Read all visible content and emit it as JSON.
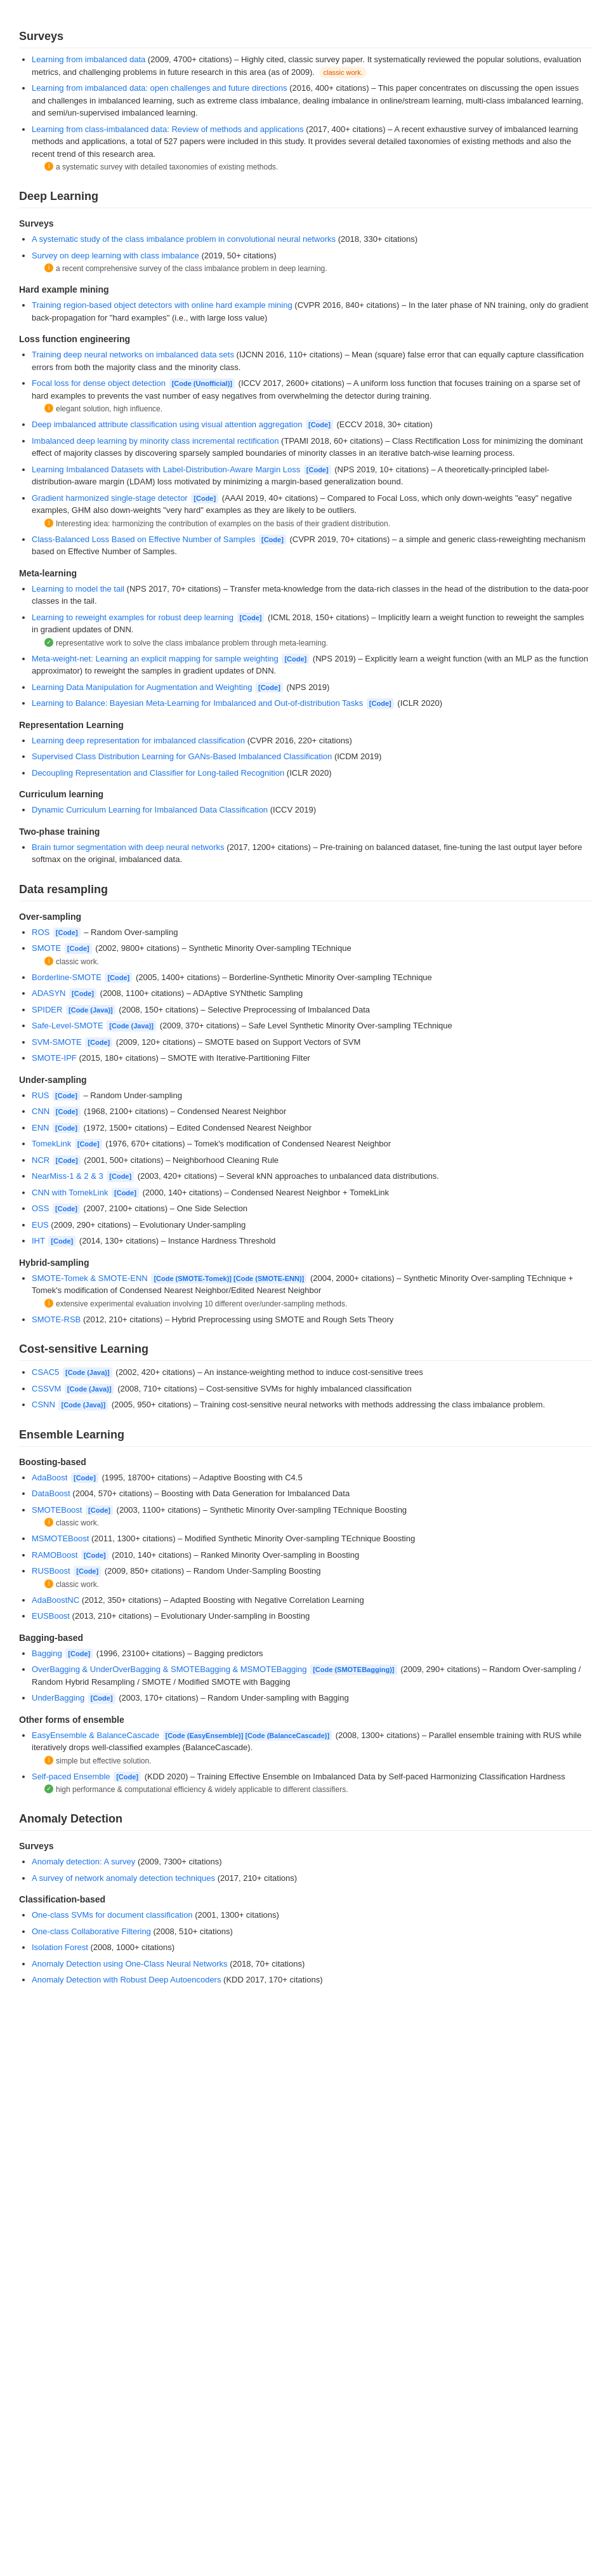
{
  "sections": [
    {
      "title": "Surveys",
      "id": "surveys-top",
      "content": {
        "subsections": [],
        "items": [
          {
            "link": "Learning from imbalanced data",
            "meta": "(2009, 4700+ citations)",
            "desc": "– Highly cited, classic survey paper. It systematically reviewed the popular solutions, evaluation metrics, and challenging problems in future research in this area (as of 2009).",
            "badge": "classic work."
          },
          {
            "link": "Learning from imbalanced data: open challenges and future directions",
            "meta": "(2016, 400+ citations)",
            "desc": "– This paper concentrates on discussing the open issues and challenges in imbalanced learning, such as extreme class imbalance, dealing imbalance in online/stream learning, multi-class imbalanced learning, and semi/un-supervised imbalanced learning."
          },
          {
            "link": "Learning from class-imbalanced data: Review of methods and applications",
            "meta": "(2017, 400+ citations)",
            "desc": "– A recent exhaustive survey of imbalanced learning methods and applications, a total of 527 papers were included in this study. It provides several detailed taxonomies of existing methods and also the recent trend of this research area.",
            "sub_note": "a systematic survey with detailed taxonomies of existing methods.",
            "sub_note_icon": "orange"
          }
        ]
      }
    },
    {
      "title": "Deep Learning",
      "id": "deep-learning",
      "content": {
        "subsections": [
          {
            "label": "Surveys",
            "items": [
              {
                "link": "A systematic study of the class imbalance problem in convolutional neural networks",
                "meta": "(2018, 330+ citations)"
              },
              {
                "link": "Survey on deep learning with class imbalance",
                "meta": "(2019, 50+ citations)",
                "sub_note": "a recent comprehensive survey of the class imbalance problem in deep learning.",
                "sub_note_icon": "orange"
              }
            ]
          },
          {
            "label": "Hard example mining",
            "items": [
              {
                "link": "Training region-based object detectors with online hard example mining",
                "meta": "(CVPR 2016, 840+ citations)",
                "desc": "– In the later phase of NN training, only do gradient back-propagation for \"hard examples\" (i.e., with large loss value)"
              }
            ]
          },
          {
            "label": "Loss function engineering",
            "items": [
              {
                "link": "Training deep neural networks on imbalanced data sets",
                "meta": "(IJCNN 2016, 110+ citations)",
                "desc": "– Mean (square) false error that can equally capture classification errors from both the majority class and the minority class."
              },
              {
                "link": "Focal loss for dense object detection",
                "tag": "[Code (Unofficial)]",
                "meta": "(ICCV 2017, 2600+ citations)",
                "desc": "– A uniform loss function that focuses training on a sparse set of hard examples to prevents the vast number of easy negatives from overwhelming the detector during training.",
                "sub_note": "elegant solution, high influence.",
                "sub_note_icon": "orange"
              },
              {
                "link": "Deep imbalanced attribute classification using visual attention aggregation",
                "tag": "[Code]",
                "meta": "(ECCV 2018, 30+ citation)"
              },
              {
                "link": "Imbalanced deep learning by minority class incremental rectification",
                "meta": "(TPAMI 2018, 60+ citations)",
                "desc": "– Class Rectification Loss for minimizing the dominant effect of majority classes by discovering sparsely sampled boundaries of minority classes in an iterative batch-wise learning process."
              },
              {
                "link": "Learning Imbalanced Datasets with Label-Distribution-Aware Margin Loss",
                "tag": "[Code]",
                "meta": "(NPS 2019, 10+ citations)",
                "desc": "– A theoretically-principled label-distribution-aware margin (LDAM) loss motivated by minimizing a margin-based generalization bound."
              },
              {
                "link": "Gradient harmonized single-stage detector",
                "tag": "[Code]",
                "meta": "(AAAI 2019, 40+ citations)",
                "desc": "– Compared to Focal Loss, which only down-weights \"easy\" negative examples, GHM also down-weights \"very hard\" examples as they are likely to be outliers.",
                "sub_note": "Interesting idea: harmonizing the contribution of examples on the basis of their gradient distribution.",
                "sub_note_icon": "orange"
              },
              {
                "link": "Class-Balanced Loss Based on Effective Number of Samples",
                "tag": "[Code]",
                "meta": "(CVPR 2019, 70+ citations)",
                "desc": "– a simple and generic class-reweighting mechanism based on Effective Number of Samples."
              }
            ]
          },
          {
            "label": "Meta-learning",
            "items": [
              {
                "link": "Learning to model the tail",
                "meta": "(NPS 2017, 70+ citations)",
                "desc": "– Transfer meta-knowledge from the data-rich classes in the head of the distribution to the data-poor classes in the tail."
              },
              {
                "link": "Learning to reweight examples for robust deep learning",
                "tag": "[Code]",
                "meta": "(ICML 2018, 150+ citations)",
                "desc": "– Implicitly learn a weight function to reweight the samples in gradient updates of DNN.",
                "sub_note": "representative work to solve the class imbalance problem through meta-learning.",
                "sub_note_icon": "green"
              },
              {
                "link": "Meta-weight-net: Learning an explicit mapping for sample weighting",
                "tag": "[Code]",
                "meta": "(NPS 2019)",
                "desc": "– Explicitly learn a weight function (with an MLP as the function approximator) to reweight the samples in gradient updates of DNN."
              },
              {
                "link": "Learning Data Manipulation for Augmentation and Weighting",
                "tag": "[Code]",
                "meta": "(NPS 2019)"
              },
              {
                "link": "Learning to Balance: Bayesian Meta-Learning for Imbalanced and Out-of-distribution Tasks",
                "tag": "[Code]",
                "meta": "(ICLR 2020)"
              }
            ]
          },
          {
            "label": "Representation Learning",
            "items": [
              {
                "link": "Learning deep representation for imbalanced classification",
                "meta": "(CVPR 2016, 220+ citations)"
              },
              {
                "link": "Supervised Class Distribution Learning for GANs-Based Imbalanced Classification",
                "meta": "(ICDM 2019)"
              },
              {
                "link": "Decoupling Representation and Classifier for Long-tailed Recognition",
                "meta": "(ICLR 2020)"
              }
            ]
          },
          {
            "label": "Curriculum learning",
            "items": [
              {
                "link": "Dynamic Curriculum Learning for Imbalanced Data Classification",
                "meta": "(ICCV 2019)"
              }
            ]
          },
          {
            "label": "Two-phase training",
            "items": [
              {
                "link": "Brain tumor segmentation with deep neural networks",
                "meta": "(2017, 1200+ citations)",
                "desc": "– Pre-training on balanced dataset, fine-tuning the last output layer before softmax on the original, imbalanced data."
              }
            ]
          }
        ]
      }
    },
    {
      "title": "Data resampling",
      "id": "data-resampling",
      "content": {
        "subsections": [
          {
            "label": "Over-sampling",
            "items": [
              {
                "link": "ROS",
                "tag": "[Code]",
                "desc": "– Random Over-sampling"
              },
              {
                "link": "SMOTE",
                "tag": "[Code]",
                "meta": "(2002, 9800+ citations)",
                "desc": "– Synthetic Minority Over-sampling TEchnique",
                "sub_note": "classic work.",
                "sub_note_icon": "orange"
              },
              {
                "link": "Borderline-SMOTE",
                "tag": "[Code]",
                "meta": "(2005, 1400+ citations)",
                "desc": "– Borderline-Synthetic Minority Over-sampling TEchnique"
              },
              {
                "link": "ADASYN",
                "tag": "[Code]",
                "meta": "(2008, 1100+ citations)",
                "desc": "– ADAptive SYNthetic Sampling"
              },
              {
                "link": "SPIDER",
                "tag": "[Code (Java)]",
                "meta": "(2008, 150+ citations)",
                "desc": "– Selective Preprocessing of Imbalanced Data"
              },
              {
                "link": "Safe-Level-SMOTE",
                "tag": "[Code (Java)]",
                "meta": "(2009, 370+ citations)",
                "desc": "– Safe Level Synthetic Minority Over-sampling TEchnique"
              },
              {
                "link": "SVM-SMOTE",
                "tag": "[Code]",
                "meta": "(2009, 120+ citations)",
                "desc": "– SMOTE based on Support Vectors of SVM"
              },
              {
                "link": "SMOTE-IPF",
                "meta": "(2015, 180+ citations)",
                "desc": "– SMOTE with Iterative-Partitioning Filter"
              }
            ]
          },
          {
            "label": "Under-sampling",
            "items": [
              {
                "link": "RUS",
                "tag": "[Code]",
                "desc": "– Random Under-sampling"
              },
              {
                "link": "CNN",
                "tag": "[Code]",
                "meta": "(1968, 2100+ citations)",
                "desc": "– Condensed Nearest Neighbor"
              },
              {
                "link": "ENN",
                "tag": "[Code]",
                "meta": "(1972, 1500+ citations)",
                "desc": "– Edited Condensed Nearest Neighbor"
              },
              {
                "link": "TomekLink",
                "tag": "[Code]",
                "meta": "(1976, 670+ citations)",
                "desc": "– Tomek's modification of Condensed Nearest Neighbor"
              },
              {
                "link": "NCR",
                "tag": "[Code]",
                "meta": "(2001, 500+ citations)",
                "desc": "– Neighborhood Cleaning Rule"
              },
              {
                "link": "NearMiss-1 & 2 & 3",
                "tag": "[Code]",
                "meta": "(2003, 420+ citations)",
                "desc": "– Several kNN approaches to unbalanced data distributions."
              },
              {
                "link": "CNN with TomekLink",
                "tag": "[Code]",
                "meta": "(2000, 140+ citations)",
                "desc": "– Condensed Nearest Neighbor + TomekLink"
              },
              {
                "link": "OSS",
                "tag": "[Code]",
                "meta": "(2007, 2100+ citations)",
                "desc": "– One Side Selection"
              },
              {
                "link": "EUS",
                "meta": "(2009, 290+ citations)",
                "desc": "– Evolutionary Under-sampling"
              },
              {
                "link": "IHT",
                "tag": "[Code]",
                "meta": "(2014, 130+ citations)",
                "desc": "– Instance Hardness Threshold"
              }
            ]
          },
          {
            "label": "Hybrid-sampling",
            "items": [
              {
                "link": "SMOTE-Tomek & SMOTE-ENN",
                "tag": "[Code (SMOTE-Tomek)] [Code (SMOTE-ENN)]",
                "meta": "(2004, 2000+ citations)",
                "desc": "– Synthetic Minority Over-sampling TEchnique + Tomek's modification of Condensed Nearest Neighbor/Edited Nearest Neighbor",
                "sub_note": "extensive experimental evaluation involving 10 different over/under-sampling methods.",
                "sub_note_icon": "orange"
              },
              {
                "link": "SMOTE-RSB",
                "meta": "(2012, 210+ citations)",
                "desc": "– Hybrid Preprocessing using SMOTE and Rough Sets Theory"
              }
            ]
          }
        ]
      }
    },
    {
      "title": "Cost-sensitive Learning",
      "id": "cost-sensitive",
      "content": {
        "subsections": [],
        "items": [
          {
            "link": "CSAC5",
            "tag": "[Code (Java)]",
            "meta": "(2002, 420+ citations)",
            "desc": "– An instance-weighting method to induce cost-sensitive trees"
          },
          {
            "link": "CSSVM",
            "tag": "[Code (Java)]",
            "meta": "(2008, 710+ citations)",
            "desc": "– Cost-sensitive SVMs for highly imbalanced classification"
          },
          {
            "link": "CSNN",
            "tag": "[Code (Java)]",
            "meta": "(2005, 950+ citations)",
            "desc": "– Training cost-sensitive neural networks with methods addressing the class imbalance problem."
          }
        ]
      }
    },
    {
      "title": "Ensemble Learning",
      "id": "ensemble",
      "content": {
        "subsections": [
          {
            "label": "Boosting-based",
            "items": [
              {
                "link": "AdaBoost",
                "tag": "[Code]",
                "meta": "(1995, 18700+ citations)",
                "desc": "– Adaptive Boosting with C4.5"
              },
              {
                "link": "DataBoost",
                "meta": "(2004, 570+ citations)",
                "desc": "– Boosting with Data Generation for Imbalanced Data"
              },
              {
                "link": "SMOTEBoost",
                "tag": "[Code]",
                "meta": "(2003, 1100+ citations)",
                "desc": "– Synthetic Minority Over-sampling TEchnique Boosting",
                "sub_note": "classic work.",
                "sub_note_icon": "orange"
              },
              {
                "link": "MSMOTEBoost",
                "meta": "(2011, 1300+ citations)",
                "desc": "– Modified Synthetic Minority Over-sampling TEchnique Boosting"
              },
              {
                "link": "RAMOBoost",
                "tag": "[Code]",
                "meta": "(2010, 140+ citations)",
                "desc": "– Ranked Minority Over-sampling in Boosting"
              },
              {
                "link": "RUSBoost",
                "tag": "[Code]",
                "meta": "(2009, 850+ citations)",
                "desc": "– Random Under-Sampling Boosting",
                "sub_note": "classic work.",
                "sub_note_icon": "orange"
              },
              {
                "link": "AdaBoostNC",
                "meta": "(2012, 350+ citations)",
                "desc": "– Adapted Boosting with Negative Correlation Learning"
              },
              {
                "link": "EUSBoost",
                "meta": "(2013, 210+ citations)",
                "desc": "– Evolutionary Under-sampling in Boosting"
              }
            ]
          },
          {
            "label": "Bagging-based",
            "items": [
              {
                "link": "Bagging",
                "tag": "[Code]",
                "meta": "(1996, 23100+ citations)",
                "desc": "– Bagging predictors"
              },
              {
                "link": "OverBagging & UnderOverBagging & SMOTEBagging & MSMOTEBagging",
                "tag": "[Code (SMOTEBagging)]",
                "meta": "(2009, 290+ citations)",
                "desc": "– Random Over-sampling / Random Hybrid Resampling / SMOTE / Modified SMOTE with Bagging"
              },
              {
                "link": "UnderBagging",
                "tag": "[Code]",
                "meta": "(2003, 170+ citations)",
                "desc": "– Random Under-sampling with Bagging"
              }
            ]
          },
          {
            "label": "Other forms of ensemble",
            "items": [
              {
                "link": "EasyEnsemble & BalanceCascade",
                "tag": "[Code (EasyEnsemble)] [Code (BalanceCascade)]",
                "meta": "(2008, 1300+ citations)",
                "desc": "– Parallel ensemble training with RUS while iteratively drops well-classified examples (BalanceCascade).",
                "sub_note": "simple but effective solution.",
                "sub_note_icon": "orange"
              },
              {
                "link": "Self-paced Ensemble",
                "tag": "[Code]",
                "meta": "(KDD 2020)",
                "desc": "– Training Effective Ensemble on Imbalanced Data by Self-paced Harmonizing Classification Hardness",
                "sub_note": "high performance & computational efficiency & widely applicable to different classifiers.",
                "sub_note_icon": "green"
              }
            ]
          }
        ]
      }
    },
    {
      "title": "Anomaly Detection",
      "id": "anomaly-detection",
      "content": {
        "subsections": [
          {
            "label": "Surveys",
            "items": [
              {
                "link": "Anomaly detection: A survey",
                "meta": "(2009, 7300+ citations)"
              },
              {
                "link": "A survey of network anomaly detection techniques",
                "meta": "(2017, 210+ citations)"
              }
            ]
          },
          {
            "label": "Classification-based",
            "items": [
              {
                "link": "One-class SVMs for document classification",
                "meta": "(2001, 1300+ citations)"
              },
              {
                "link": "One-class Collaborative Filtering",
                "meta": "(2008, 510+ citations)"
              },
              {
                "link": "Isolation Forest",
                "meta": "(2008, 1000+ citations)"
              },
              {
                "link": "Anomaly Detection using One-Class Neural Networks",
                "meta": "(2018, 70+ citations)"
              },
              {
                "link": "Anomaly Detection with Robust Deep Autoencoders",
                "meta": "(KDD 2017, 170+ citations)"
              }
            ]
          }
        ]
      }
    }
  ]
}
